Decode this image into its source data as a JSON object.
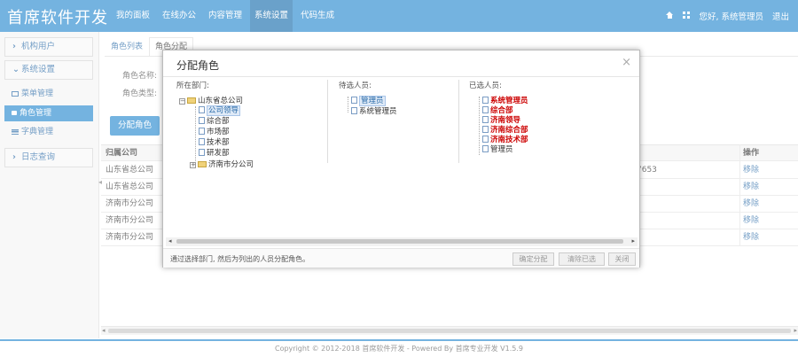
{
  "app": {
    "brand": "首席软件开发"
  },
  "nav": {
    "items": [
      "我的面板",
      "在线办公",
      "内容管理",
      "系统设置",
      "代码生成"
    ],
    "active_index": 3
  },
  "topright": {
    "greeting": "您好, 系统管理员",
    "logout": "退出"
  },
  "sidebar": {
    "org_users": "机构用户",
    "system_settings": "系统设置",
    "menu_mgmt": "菜单管理",
    "role_mgmt": "角色管理",
    "dict_mgmt": "字典管理",
    "log_query": "日志查询"
  },
  "tabs": {
    "role_list": "角色列表",
    "role_assign": "角色分配"
  },
  "form": {
    "role_name_label": "角色名称:",
    "role_type_label": "角色类型:"
  },
  "main": {
    "assign_button": "分配角色"
  },
  "table": {
    "headers": {
      "company": "归属公司",
      "action": "操作"
    },
    "rows": [
      {
        "company": "山东省总公司",
        "extra": "7653",
        "action": "移除"
      },
      {
        "company": "山东省总公司",
        "extra": "",
        "action": "移除"
      },
      {
        "company": "济南市分公司",
        "extra": "",
        "action": "移除"
      },
      {
        "company": "济南市分公司",
        "extra": "",
        "action": "移除"
      },
      {
        "company": "济南市分公司",
        "extra": "",
        "action": "移除"
      }
    ]
  },
  "footer": {
    "text": "Copyright © 2012-2018 首席软件开发 - Powered By 首席专业开发 V1.5.9"
  },
  "modal": {
    "title": "分配角色",
    "close": "×",
    "dept_title": "所在部门:",
    "candidate_title": "待选人员:",
    "selected_title": "已选人员:",
    "dept_tree": {
      "root": "山东省总公司",
      "children": [
        "公司领导",
        "综合部",
        "市场部",
        "技术部",
        "研发部"
      ],
      "sibling": "济南市分公司"
    },
    "candidates": [
      "管理员",
      "系统管理员"
    ],
    "selected": [
      "系统管理员",
      "综合部",
      "济南领导",
      "济南综合部",
      "济南技术部",
      "管理员"
    ],
    "hint": "通过选择部门, 然后为列出的人员分配角色。",
    "buttons": {
      "confirm": "确定分配",
      "clear": "清除已选",
      "close": "关闭"
    }
  }
}
